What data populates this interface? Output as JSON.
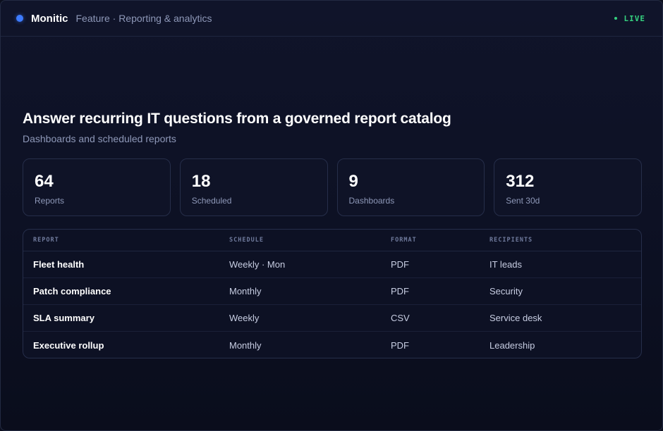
{
  "header": {
    "brand": "Monitic",
    "subtitle": "Feature · Reporting & analytics",
    "status": "LIVE"
  },
  "hero": {
    "title": "Answer recurring IT questions from a governed report catalog",
    "subtitle": "Dashboards and scheduled reports"
  },
  "stats": [
    {
      "value": "64",
      "label": "Reports"
    },
    {
      "value": "18",
      "label": "Scheduled"
    },
    {
      "value": "9",
      "label": "Dashboards"
    },
    {
      "value": "312",
      "label": "Sent 30d"
    }
  ],
  "table": {
    "columns": [
      "REPORT",
      "SCHEDULE",
      "FORMAT",
      "RECIPIENTS"
    ],
    "rows": [
      [
        "Fleet health",
        "Weekly · Mon",
        "PDF",
        "IT leads"
      ],
      [
        "Patch compliance",
        "Monthly",
        "PDF",
        "Security"
      ],
      [
        "SLA summary",
        "Weekly",
        "CSV",
        "Service desk"
      ],
      [
        "Executive rollup",
        "Monthly",
        "PDF",
        "Leadership"
      ]
    ]
  },
  "colors": {
    "accent": "#3d7bff",
    "live": "#35d07f",
    "background": "#0c0f1e"
  }
}
